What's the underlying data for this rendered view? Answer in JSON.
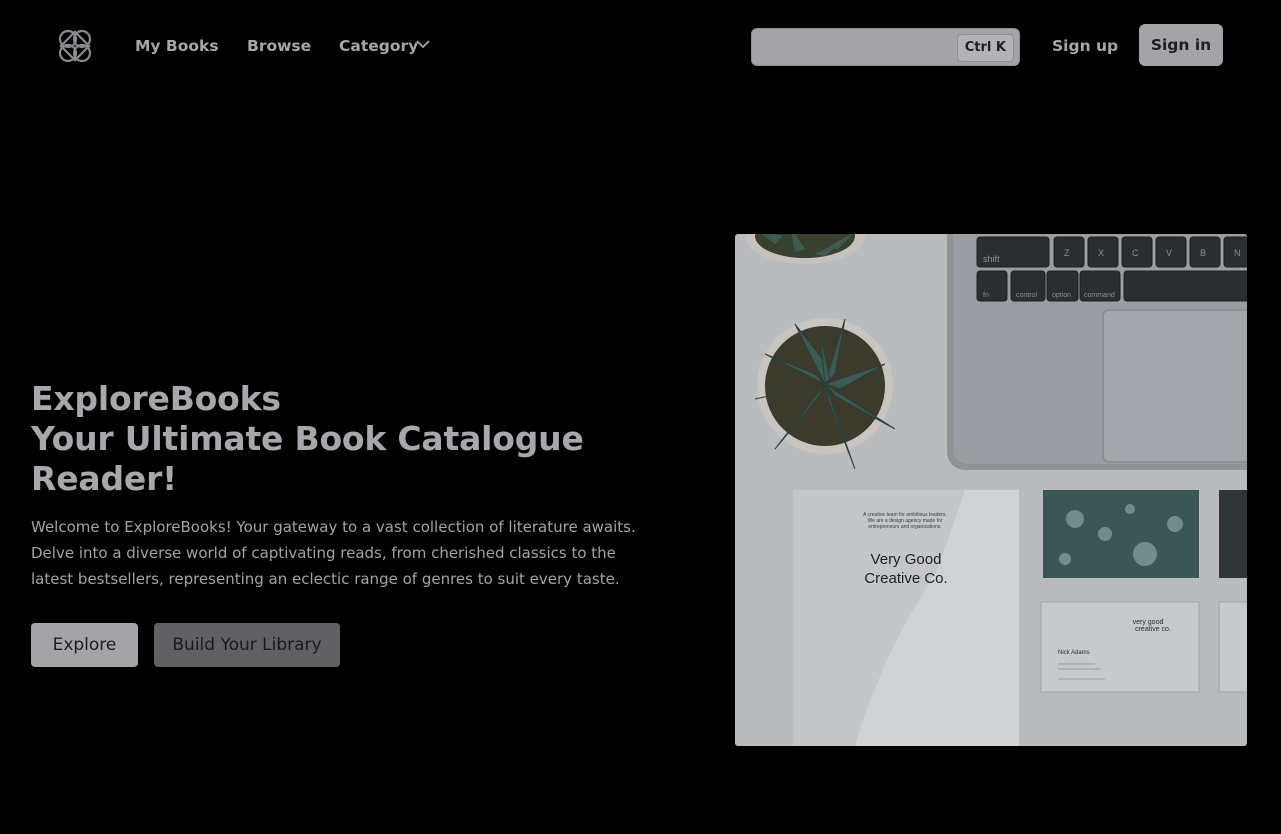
{
  "nav": {
    "logo": "interlaced-knot-logo",
    "links": [
      "My Books",
      "Browse",
      "Category"
    ],
    "category_icon": "chevron-down-icon"
  },
  "search": {
    "placeholder": "",
    "shortcut": "Ctrl K"
  },
  "auth": {
    "signup": "Sign up",
    "signin": "Sign in"
  },
  "hero": {
    "title_lines": [
      "ExploreBooks",
      "Your Ultimate Book Catalogue",
      "Reader!"
    ],
    "description": "Welcome to ExploreBooks! Your gateway to a vast collection of literature awaits. Delve into a diverse world of captivating reads, from cherished classics to the latest bestsellers, representing an eclectic range of genres to suit every taste.",
    "buttons": {
      "explore": "Explore",
      "build": "Build Your Library"
    },
    "image": {
      "keys_row1": [
        "shift",
        "Z",
        "X",
        "C",
        "V",
        "B",
        "N"
      ],
      "keys_row2": [
        "fn",
        "control",
        "option",
        "command"
      ],
      "card_title": [
        "Very Good",
        "Creative Co."
      ],
      "card_tagline": [
        "A creative team for ambitious leaders.",
        "We are a design agency made for",
        "entrepreneurs and organizations."
      ],
      "business_card_brand": [
        "very good",
        "creative co."
      ],
      "business_card_name": "Nick Adams"
    }
  },
  "colors": {
    "background": "#000000",
    "text": "#a7a7ac",
    "primary_button": "#a3a3a8",
    "secondary_button": "#616164"
  }
}
